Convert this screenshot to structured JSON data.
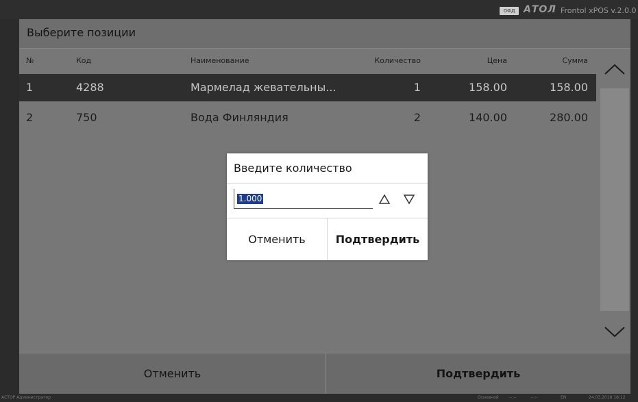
{
  "topbar": {
    "ofd_badge": "ОФД",
    "brand": "АТОЛ",
    "version": "Frontol xPOS v.2.0.0"
  },
  "window": {
    "title": "Выберите позиции",
    "columns": [
      "№",
      "Код",
      "Наименование",
      "Количество",
      "Цена",
      "Сумма"
    ],
    "rows": [
      {
        "no": "1",
        "code": "4288",
        "name": "Мармелад жевательны...",
        "qty": "1",
        "price": "158.00",
        "sum": "158.00",
        "selected": true
      },
      {
        "no": "2",
        "code": "750",
        "name": "Вода Финляндия",
        "qty": "2",
        "price": "140.00",
        "sum": "280.00",
        "selected": false
      }
    ],
    "cancel_label": "Отменить",
    "confirm_label": "Подтвердить"
  },
  "dialog": {
    "title": "Введите количество",
    "value": "1.000",
    "cancel_label": "Отменить",
    "confirm_label": "Подтвердить"
  },
  "status_bar": {
    "user": "АСТОР Администратор",
    "mode": "Основной",
    "d1": "--:--",
    "d2": "--:--",
    "lang": "EN",
    "datetime": "24.03.2018 18:12"
  },
  "colors": {
    "background": "#2b2b2b",
    "window": "#777777",
    "selected_row": "#2e2e2e",
    "dialog": "#ffffff",
    "text_selection": "#1e3d8f"
  }
}
